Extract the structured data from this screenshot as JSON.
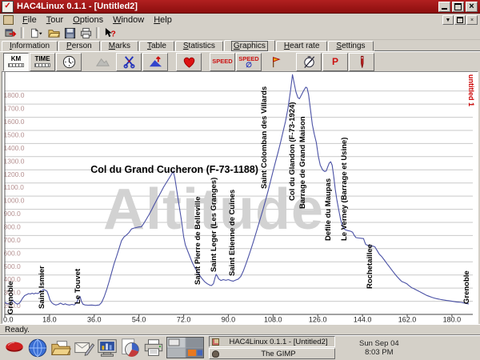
{
  "window": {
    "title": "HAC4Linux 0.1.1 - [Untitled2]"
  },
  "menubar": {
    "items": [
      "File",
      "Tour",
      "Options",
      "Window",
      "Help"
    ]
  },
  "tabs": {
    "items": [
      "Information",
      "Person",
      "Marks",
      "Table",
      "Statistics",
      "Graphics",
      "Heart rate",
      "Settings"
    ],
    "active": "Graphics"
  },
  "toolbar_graphics": {
    "km_label": "KM",
    "time_label": "TIME",
    "speed_label": "SPEED",
    "speed_average_label": "SPEED",
    "power_label": "P"
  },
  "statusbar": {
    "text": "Ready."
  },
  "taskbar": {
    "windows": [
      {
        "title": "HAC4Linux 0.1.1 - [Untitled2]"
      },
      {
        "title": "The GIMP"
      }
    ],
    "clock": {
      "date": "Sun Sep 04",
      "time": "8:03 PM"
    }
  },
  "chart_data": {
    "type": "line",
    "title_watermark": "Altitude",
    "doc_label": "untitled 1",
    "line_color": "#4a51a5",
    "grid_color": "#c9c9c9",
    "ylabel_color": "#b59090",
    "xlabel_color": "#222222",
    "watermark_color": "#d2d2d2",
    "doc_label_color": "#cc0000",
    "ylim": [
      100,
      1950
    ],
    "xlim": [
      0,
      187
    ],
    "x_ticks": [
      0,
      18,
      36,
      54,
      72,
      90,
      108,
      126,
      144,
      162,
      180
    ],
    "y_ticks": [
      200,
      300,
      400,
      500,
      600,
      700,
      800,
      900,
      1000,
      1100,
      1200,
      1300,
      1400,
      1500,
      1600,
      1700,
      1800
    ],
    "annotations": [
      {
        "text": "Grenoble",
        "km": 3.2,
        "y": 303,
        "rotate": true
      },
      {
        "text": "Saint Ismier",
        "km": 15.8,
        "y": 296,
        "rotate": true
      },
      {
        "text": "Le Touvet",
        "km": 30.3,
        "y": 290,
        "rotate": true
      },
      {
        "text": "Col du Grand Cucheron (F-73-1188)",
        "km": 68.3,
        "y": 126,
        "rotate": false,
        "size": 12.5
      },
      {
        "text": "Saint Pierre de Belleville",
        "km": 78.6,
        "y": 266,
        "rotate": true
      },
      {
        "text": "Saint Leger (Les Granges)",
        "km": 85.0,
        "y": 250,
        "rotate": true
      },
      {
        "text": "Saint Etienne de Cuines",
        "km": 92.4,
        "y": 255,
        "rotate": true
      },
      {
        "text": "Saint Colomban des Villards",
        "km": 105.3,
        "y": 146,
        "rotate": true
      },
      {
        "text": "Col du Glandon (F-73-1924)",
        "km": 116.6,
        "y": 161,
        "rotate": true
      },
      {
        "text": "Barrage de Grand Maison",
        "km": 120.8,
        "y": 171,
        "rotate": true
      },
      {
        "text": "Defile du Maupas",
        "km": 131.0,
        "y": 211,
        "rotate": true
      },
      {
        "text": "Le Verney (Barrage et Usine)",
        "km": 137.5,
        "y": 211,
        "rotate": true
      },
      {
        "text": "Rochetaillee",
        "km": 147.8,
        "y": 271,
        "rotate": true
      },
      {
        "text": "Grenoble",
        "km": 186.8,
        "y": 290,
        "rotate": true
      }
    ],
    "profile": [
      [
        0,
        192
      ],
      [
        0.7,
        184
      ],
      [
        1.5,
        180
      ],
      [
        2.2,
        178
      ],
      [
        2.8,
        200
      ],
      [
        3.2,
        210
      ],
      [
        3.7,
        196
      ],
      [
        4.5,
        184
      ],
      [
        5.2,
        178
      ],
      [
        6,
        188
      ],
      [
        6.6,
        205
      ],
      [
        7.2,
        225
      ],
      [
        8,
        243
      ],
      [
        9,
        252
      ],
      [
        9.6,
        258
      ],
      [
        10.3,
        255
      ],
      [
        11,
        261
      ],
      [
        11.7,
        256
      ],
      [
        12.4,
        262
      ],
      [
        13.1,
        258
      ],
      [
        14,
        266
      ],
      [
        15,
        282
      ],
      [
        15.6,
        290
      ],
      [
        16.2,
        285
      ],
      [
        17,
        276
      ],
      [
        17.6,
        246
      ],
      [
        18.2,
        210
      ],
      [
        18.8,
        191
      ],
      [
        19.5,
        180
      ],
      [
        20.5,
        171
      ],
      [
        21.5,
        176
      ],
      [
        22.4,
        186
      ],
      [
        23,
        180
      ],
      [
        23.6,
        175
      ],
      [
        24.3,
        181
      ],
      [
        25,
        175
      ],
      [
        26,
        171
      ],
      [
        27,
        176
      ],
      [
        28,
        172
      ],
      [
        29,
        192
      ],
      [
        29.8,
        226
      ],
      [
        30.3,
        235
      ],
      [
        30.9,
        198
      ],
      [
        31.5,
        177
      ],
      [
        32.3,
        172
      ],
      [
        33.5,
        170
      ],
      [
        35,
        171
      ],
      [
        36.5,
        168
      ],
      [
        38,
        172
      ],
      [
        39,
        191
      ],
      [
        40,
        234
      ],
      [
        41,
        288
      ],
      [
        42,
        350
      ],
      [
        43,
        418
      ],
      [
        44,
        485
      ],
      [
        45,
        541
      ],
      [
        46,
        601
      ],
      [
        47,
        661
      ],
      [
        48,
        689
      ],
      [
        49,
        704
      ],
      [
        50,
        723
      ],
      [
        51,
        750
      ],
      [
        52,
        757
      ],
      [
        53,
        761
      ],
      [
        54,
        765
      ],
      [
        55,
        767
      ],
      [
        56,
        794
      ],
      [
        57,
        825
      ],
      [
        58,
        857
      ],
      [
        59,
        891
      ],
      [
        60,
        929
      ],
      [
        61,
        965
      ],
      [
        62,
        1000
      ],
      [
        63,
        1035
      ],
      [
        64,
        1071
      ],
      [
        65,
        1101
      ],
      [
        66,
        1131
      ],
      [
        67,
        1162
      ],
      [
        67.8,
        1188
      ],
      [
        68.4,
        1143
      ],
      [
        69,
        1073
      ],
      [
        70,
        950
      ],
      [
        71,
        828
      ],
      [
        72,
        690
      ],
      [
        72.7,
        628
      ],
      [
        73.5,
        589
      ],
      [
        74.5,
        541
      ],
      [
        75.5,
        494
      ],
      [
        76.5,
        456
      ],
      [
        77.5,
        425
      ],
      [
        78.5,
        395
      ],
      [
        79.5,
        370
      ],
      [
        80.5,
        348
      ],
      [
        81.5,
        333
      ],
      [
        82.5,
        323
      ],
      [
        83.2,
        319
      ],
      [
        84,
        334
      ],
      [
        84.7,
        383
      ],
      [
        85.1,
        405
      ],
      [
        85.6,
        390
      ],
      [
        86.1,
        370
      ],
      [
        87,
        358
      ],
      [
        88,
        365
      ],
      [
        89,
        359
      ],
      [
        90,
        365
      ],
      [
        91,
        357
      ],
      [
        92,
        353
      ],
      [
        93,
        362
      ],
      [
        94,
        369
      ],
      [
        95,
        389
      ],
      [
        96,
        429
      ],
      [
        97,
        480
      ],
      [
        98,
        534
      ],
      [
        99,
        590
      ],
      [
        100,
        649
      ],
      [
        101,
        711
      ],
      [
        102,
        774
      ],
      [
        103,
        837
      ],
      [
        104,
        901
      ],
      [
        105,
        969
      ],
      [
        106,
        1039
      ],
      [
        107,
        1114
      ],
      [
        108,
        1189
      ],
      [
        109,
        1261
      ],
      [
        110,
        1334
      ],
      [
        111,
        1409
      ],
      [
        112,
        1489
      ],
      [
        113,
        1569
      ],
      [
        114,
        1669
      ],
      [
        115,
        1800
      ],
      [
        115.8,
        1924
      ],
      [
        116.4,
        1868
      ],
      [
        117.2,
        1793
      ],
      [
        118,
        1749
      ],
      [
        118.6,
        1741
      ],
      [
        119.4,
        1768
      ],
      [
        120.3,
        1802
      ],
      [
        121.2,
        1829
      ],
      [
        121.7,
        1822
      ],
      [
        122.3,
        1774
      ],
      [
        123,
        1668
      ],
      [
        123.8,
        1545
      ],
      [
        124.6,
        1470
      ],
      [
        125.4,
        1408
      ],
      [
        126.2,
        1303
      ],
      [
        127,
        1236
      ],
      [
        128,
        1198
      ],
      [
        128.8,
        1187
      ],
      [
        129.4,
        1191
      ],
      [
        130,
        1221
      ],
      [
        130.6,
        1251
      ],
      [
        131.2,
        1261
      ],
      [
        131.8,
        1235
      ],
      [
        132.4,
        1153
      ],
      [
        133,
        1055
      ],
      [
        133.7,
        971
      ],
      [
        134.4,
        899
      ],
      [
        135.1,
        829
      ],
      [
        135.8,
        780
      ],
      [
        136.4,
        753
      ],
      [
        137.2,
        743
      ],
      [
        138.2,
        737
      ],
      [
        139.2,
        733
      ],
      [
        140,
        725
      ],
      [
        140.7,
        700
      ],
      [
        141.4,
        684
      ],
      [
        142.4,
        681
      ],
      [
        143.6,
        679
      ],
      [
        144.4,
        677
      ],
      [
        144.9,
        651
      ],
      [
        145.3,
        632
      ],
      [
        146.2,
        625
      ],
      [
        147.2,
        622
      ],
      [
        148.2,
        619
      ],
      [
        149,
        614
      ],
      [
        149.8,
        589
      ],
      [
        150.8,
        558
      ],
      [
        151.8,
        539
      ],
      [
        152.8,
        514
      ],
      [
        153.8,
        488
      ],
      [
        154.8,
        463
      ],
      [
        155.8,
        437
      ],
      [
        156.8,
        413
      ],
      [
        157.8,
        390
      ],
      [
        158.8,
        369
      ],
      [
        159.8,
        350
      ],
      [
        160.8,
        343
      ],
      [
        161.8,
        334
      ],
      [
        162.8,
        317
      ],
      [
        163.8,
        303
      ],
      [
        164.8,
        295
      ],
      [
        165.8,
        285
      ],
      [
        166.8,
        275
      ],
      [
        167.8,
        265
      ],
      [
        168.8,
        255
      ],
      [
        169.8,
        245
      ],
      [
        170.8,
        238
      ],
      [
        171.8,
        231
      ],
      [
        172.8,
        225
      ],
      [
        173.8,
        220
      ],
      [
        174.8,
        216
      ],
      [
        175.8,
        212
      ],
      [
        176.8,
        209
      ],
      [
        177.8,
        206
      ],
      [
        178.8,
        204
      ],
      [
        179.8,
        201
      ],
      [
        180.8,
        198
      ],
      [
        181.8,
        195
      ],
      [
        182.8,
        193
      ],
      [
        183.8,
        191
      ],
      [
        184.8,
        187
      ],
      [
        185.8,
        183
      ],
      [
        186.8,
        180
      ]
    ]
  }
}
